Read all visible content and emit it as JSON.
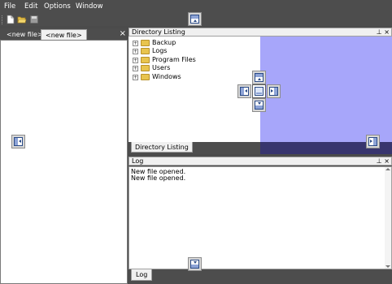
{
  "menu": {
    "file": "File",
    "edit": "Edit",
    "options": "Options",
    "window": "Window"
  },
  "toolbar": {
    "new_icon": "new-document-icon",
    "open_icon": "open-folder-icon",
    "save_icon": "save-icon"
  },
  "documents": {
    "tabs": [
      {
        "label": "<new file>"
      },
      {
        "label": "<new file>"
      }
    ],
    "close": "×"
  },
  "directory_pane": {
    "title": "Directory Listing",
    "pin": "⊥",
    "close": "×",
    "items": [
      {
        "label": "Backup"
      },
      {
        "label": "Logs"
      },
      {
        "label": "Program Files"
      },
      {
        "label": "Users"
      },
      {
        "label": "Windows"
      }
    ],
    "tab": "Directory Listing"
  },
  "log_pane": {
    "title": "Log",
    "pin": "⊥",
    "close": "×",
    "lines": [
      "New file opened.",
      "New file opened."
    ],
    "tab": "Log"
  },
  "colors": {
    "dock_preview": "#a7a6fa",
    "dock_preview_bar": "#38356e",
    "background": "#4b4b4b"
  }
}
